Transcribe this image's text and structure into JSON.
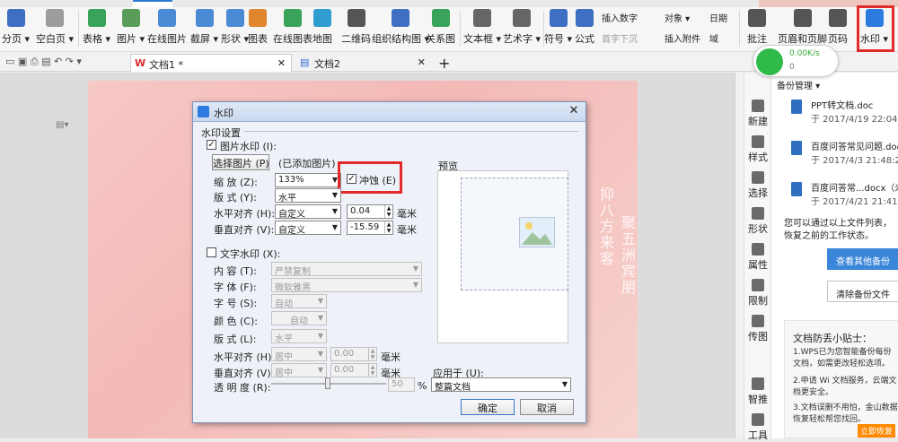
{
  "ribbon": {
    "buttons": [
      {
        "key": "page_break",
        "label": "分页 ▾",
        "color": "#3e6fc2"
      },
      {
        "key": "blank_page",
        "label": "空白页 ▾",
        "color": "#9c9c9c"
      },
      {
        "key": "table",
        "label": "表格 ▾",
        "color": "#3aa35a"
      },
      {
        "key": "image",
        "label": "图片 ▾",
        "color": "#5a9c5a"
      },
      {
        "key": "online_image",
        "label": "在线图片",
        "color": "#4b8bd6"
      },
      {
        "key": "screenshot",
        "label": "截屏 ▾",
        "color": "#4b8bd6"
      },
      {
        "key": "shape",
        "label": "形状 ▾",
        "color": "#4b8bd6"
      },
      {
        "key": "chart",
        "label": "图表",
        "color": "#e0862c"
      },
      {
        "key": "online_chart",
        "label": "在线图表",
        "color": "#3aa35a"
      },
      {
        "key": "map",
        "label": "地图",
        "color": "#2f9dd0"
      },
      {
        "key": "qr",
        "label": "二维码",
        "color": "#555"
      },
      {
        "key": "org_chart",
        "label": "组织结构图 ▾",
        "color": "#3e6fc2"
      },
      {
        "key": "relation",
        "label": "关系图",
        "color": "#3aa35a"
      },
      {
        "key": "textbox",
        "label": "文本框 ▾",
        "color": "#666"
      },
      {
        "key": "wordart",
        "label": "艺术字 ▾",
        "color": "#666"
      },
      {
        "key": "symbol",
        "label": "符号 ▾",
        "color": "#3e6fc2"
      },
      {
        "key": "formula",
        "label": "公式",
        "color": "#3e6fc2"
      },
      {
        "key": "comment",
        "label": "批注",
        "color": "#555"
      },
      {
        "key": "header_footer",
        "label": "页眉和页脚",
        "color": "#555"
      },
      {
        "key": "page_num",
        "label": "页码",
        "color": "#555"
      },
      {
        "key": "watermark",
        "label": "水印 ▾",
        "color": "#2e7be0"
      }
    ],
    "small_items": [
      "插入数字",
      "首字下沉",
      "对象 ▾",
      "插入附件",
      "日期",
      "域"
    ]
  },
  "tabs": [
    {
      "label": "文档1 *"
    },
    {
      "label": "文档2"
    }
  ],
  "network": {
    "up": "0.00K/s",
    "down": "0"
  },
  "sidebar": [
    "新建",
    "样式",
    "选择",
    "形状",
    "属性",
    "限制",
    "传图",
    "",
    "智推",
    "工具"
  ],
  "panel": {
    "title": "备份管理 ▾",
    "files": [
      {
        "name": "PPT转文档.doc",
        "date": "于 2017/4/19 22:04:23"
      },
      {
        "name": "百度问答常见问题.docx",
        "date": "于 2017/4/3 21:48:21"
      },
      {
        "name": "百度问答常...docx（未",
        "date": "于 2017/4/21 21:41:54"
      }
    ],
    "hint": "您可以通过以上文件列表，恢复之前的工作状态。",
    "view_btn": "查看其他备份",
    "clear_btn": "清除备份文件",
    "tips_title": "文档防丢小贴士：",
    "tip1": "1.WPS已为您智能备份每份文档，如需更改轻松选项。",
    "tip2": "2.申请 Wi 文档服务，云端文档更安全。",
    "tip3": "3.文档误删不用怕，金山数据恢复轻松帮您找回。",
    "badge": "立即恢复"
  },
  "page_text": {
    "right1": "抑八方来客",
    "right2": "聚五洲宾朋"
  },
  "dialog": {
    "title": "水印",
    "close": "✕",
    "group": "水印设置",
    "image_watermark": {
      "checked": true,
      "label": "图片水印  (I):"
    },
    "select_image_btn": "选择图片 (P)",
    "added_note": "(已添加图片)",
    "scale_label": "缩    放 (Z):",
    "scale_value": "133%",
    "washout": {
      "checked": true,
      "label": "冲蚀 (E)"
    },
    "layout_label": "版    式 (Y):",
    "layout_value": "水平",
    "h_align_label": "水平对齐 (H):",
    "h_align_value": "自定义",
    "h_offset": "0.04",
    "v_align_label": "垂直对齐 (V):",
    "v_align_value": "自定义",
    "v_offset": "-15.59",
    "unit": "毫米",
    "text_watermark": {
      "checked": false,
      "label": "文字水印  (X):"
    },
    "content_label": "内    容 (T):",
    "content_value": "严禁复制",
    "font_label": "字    体 (F):",
    "font_value": "微软雅黑",
    "size_label": "字    号 (S):",
    "size_value": "自动",
    "color_label": "颜    色 (C):",
    "color_value": "自动",
    "layout2_label": "版    式 (L):",
    "layout2_value": "水平",
    "h_align2_label": "水平对齐 (H):",
    "h_align2_value": "居中",
    "h_offset2": "0.00",
    "v_align2_label": "垂直对齐 (V):",
    "v_align2_value": "居中",
    "v_offset2": "0.00",
    "transparency_label": "透 明 度 (R):",
    "transparency_value": "50",
    "percent": "%",
    "preview_label": "预览",
    "apply_label": "应用于 (U):",
    "apply_value": "整篇文档",
    "ok": "确定",
    "cancel": "取消"
  }
}
